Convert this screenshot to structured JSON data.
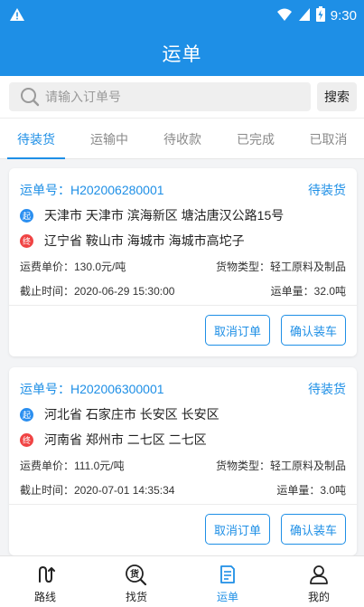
{
  "status_bar": {
    "time": "9:30"
  },
  "header": {
    "title": "运单"
  },
  "search": {
    "placeholder": "请输入订单号",
    "button_label": "搜索"
  },
  "tabs": [
    {
      "label": "待装货",
      "active": true
    },
    {
      "label": "运输中",
      "active": false
    },
    {
      "label": "待收款",
      "active": false
    },
    {
      "label": "已完成",
      "active": false
    },
    {
      "label": "已取消",
      "active": false
    }
  ],
  "orders": [
    {
      "order_no": "运单号：H202006280001",
      "status": "待装货",
      "start_badge": "起",
      "start_address": "天津市 天津市 滨海新区 塘沽唐汉公路15号",
      "end_badge": "终",
      "end_address": "辽宁省 鞍山市 海城市 海城市高坨子",
      "unit_price": "运费单价：130.0元/吨",
      "cargo_type": "货物类型：轻工原料及制品",
      "deadline": "截止时间：2020-06-29 15:30:00",
      "quantity": "运单量：32.0吨",
      "cancel_label": "取消订单",
      "confirm_label": "确认装车"
    },
    {
      "order_no": "运单号：H202006300001",
      "status": "待装货",
      "start_badge": "起",
      "start_address": "河北省 石家庄市 长安区 长安区",
      "end_badge": "终",
      "end_address": "河南省 郑州市 二七区 二七区",
      "unit_price": "运费单价：111.0元/吨",
      "cargo_type": "货物类型：轻工原料及制品",
      "deadline": "截止时间：2020-07-01 14:35:34",
      "quantity": "运单量：3.0吨",
      "cancel_label": "取消订单",
      "confirm_label": "确认装车"
    }
  ],
  "bottom_nav": [
    {
      "label": "路线",
      "icon": "route-icon",
      "active": false
    },
    {
      "label": "找货",
      "icon": "find-cargo-icon",
      "active": false,
      "icon_text": "货"
    },
    {
      "label": "运单",
      "icon": "waybill-icon",
      "active": true
    },
    {
      "label": "我的",
      "icon": "profile-icon",
      "active": false
    }
  ],
  "colors": {
    "primary": "#1e8fe6",
    "start_dot": "#2b8ff0",
    "end_dot": "#f04444"
  }
}
